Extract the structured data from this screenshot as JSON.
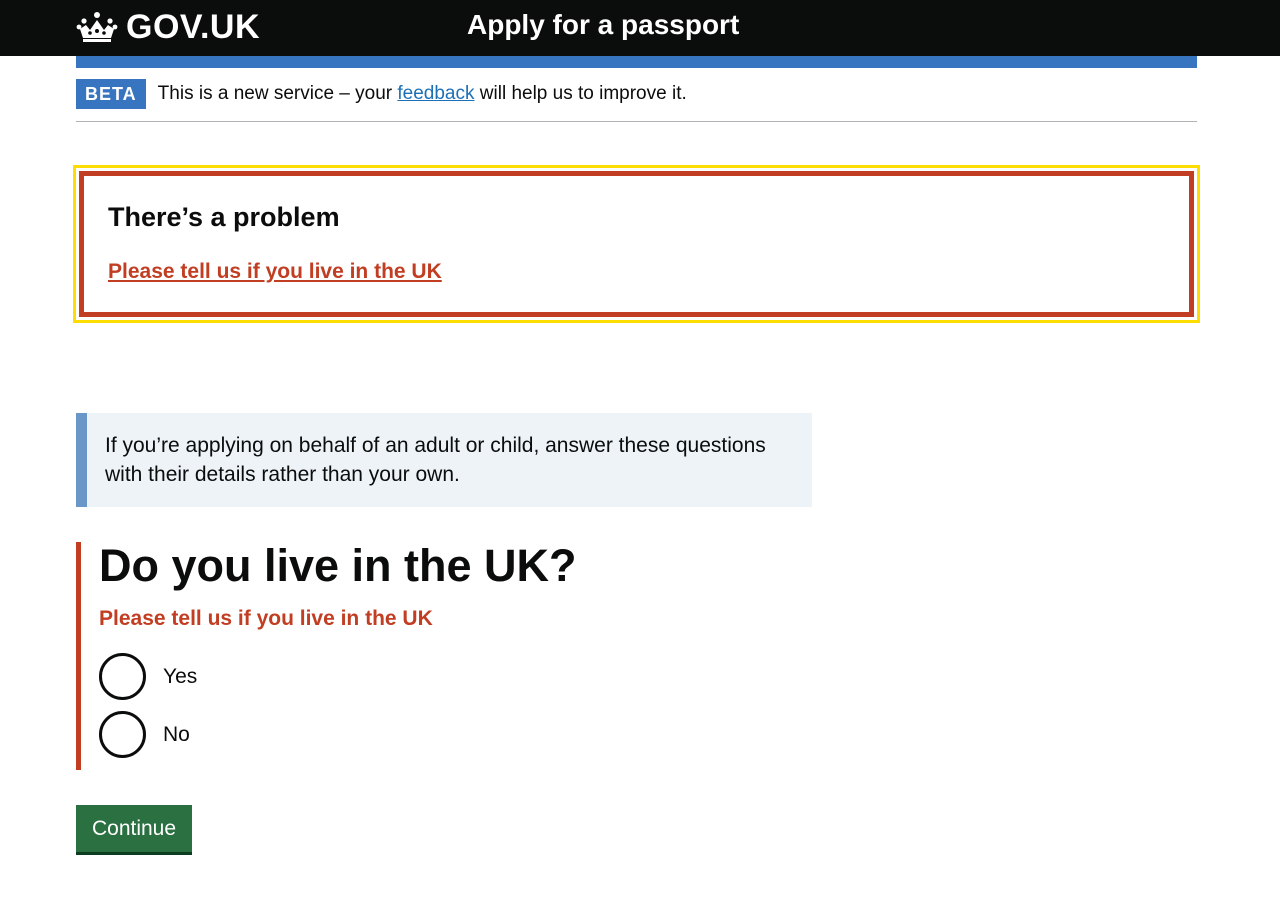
{
  "header": {
    "logo_text": "GOV.UK",
    "crown_icon": "crown-icon",
    "service_name": "Apply for a passport"
  },
  "phase_banner": {
    "tag": "BETA",
    "text_before": "This is a new service – your",
    "link_text": "feedback",
    "text_after": "will help us to improve it."
  },
  "error_summary": {
    "title": "There’s a problem",
    "items": [
      "Please tell us if you live in the UK"
    ]
  },
  "inset_text": "If you’re applying on behalf of an adult or child, answer these questions with their details rather than your own.",
  "question": {
    "heading": "Do you live in the UK?",
    "error_message": "Please tell us if you live in the UK",
    "options": [
      {
        "label": "Yes",
        "selected": false
      },
      {
        "label": "No",
        "selected": false
      }
    ]
  },
  "continue_button": "Continue",
  "colors": {
    "header_bg": "#0b0c0c",
    "brand_blue": "#3875c1",
    "error_red": "#c13e23",
    "focus_yellow": "#ffdd00",
    "inset_bg": "#eef3f8",
    "inset_border": "#6a96c8",
    "button_green": "#2a7041"
  }
}
